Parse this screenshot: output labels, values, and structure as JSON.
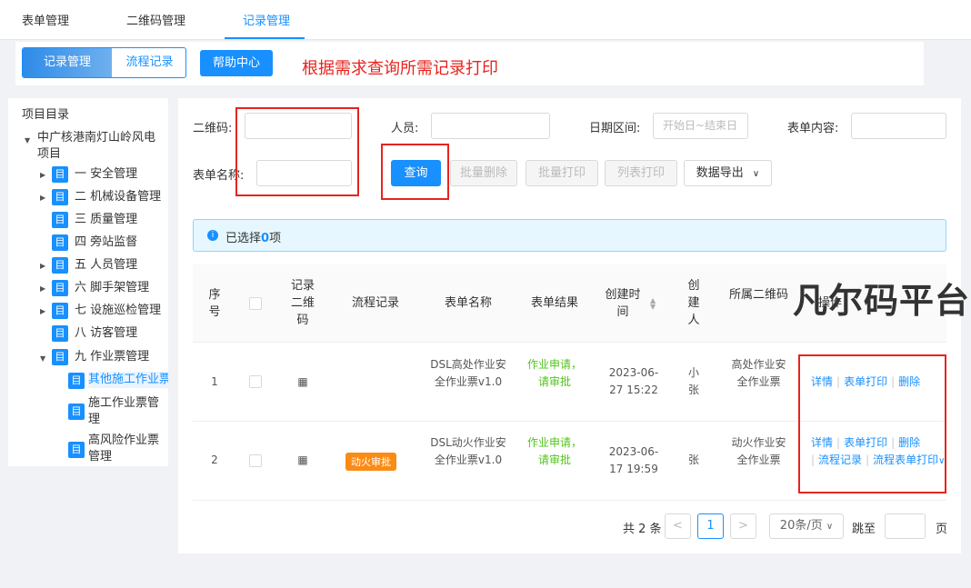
{
  "topnav": {
    "tabs": [
      "表单管理",
      "二维码管理",
      "记录管理"
    ]
  },
  "subbar": {
    "seg_active": "记录管理",
    "seg_other": "流程记录",
    "help": "帮助中心",
    "note": "根据需求查询所需记录打印"
  },
  "tree": {
    "title": "项目目录",
    "root": "中广核港南灯山岭风电项目",
    "icon": "目",
    "items": [
      "一 安全管理",
      "二 机械设备管理",
      "三 质量管理",
      "四 旁站监督",
      "五 人员管理",
      "六 脚手架管理",
      "七 设施巡检管理",
      "八 访客管理",
      "九 作业票管理"
    ],
    "sub": [
      "其他施工作业票",
      "施工作业票管理",
      "高风险作业票管理"
    ]
  },
  "filters": {
    "qrcode": "二维码:",
    "person": "人员:",
    "date": "日期区间:",
    "date_placeholder": "开始日~结束日",
    "content": "表单内容:",
    "formname": "表单名称:",
    "query": "查询",
    "batch_delete": "批量删除",
    "batch_print": "批量打印",
    "list_print": "列表打印",
    "export": "数据导出"
  },
  "alert": {
    "prefix": "已选择",
    "count": "0",
    "suffix": "项"
  },
  "table": {
    "headers": {
      "seq": "序号",
      "record_qr": "记录二维码",
      "flow": "流程记录",
      "name": "表单名称",
      "result": "表单结果",
      "created": "创建时间",
      "creator": "创建人",
      "qr_owner": "所属二维码",
      "ops": "操作"
    },
    "rows": [
      {
        "seq": "1",
        "flow": "",
        "name": "DSL高处作业安全作业票v1.0",
        "result": "作业申请，请审批",
        "created": "2023-06-27 15:22",
        "creator": "小张",
        "qr_owner": "高处作业安全作业票",
        "ops": [
          "详情",
          "表单打印",
          "删除"
        ]
      },
      {
        "seq": "2",
        "flow": "动火审批",
        "name": "DSL动火作业安全作业票v1.0",
        "result": "作业申请，请审批",
        "created": "2023-06-17 19:59",
        "creator": "张",
        "qr_owner": "动火作业安全作业票",
        "ops": [
          "详情",
          "表单打印",
          "删除",
          "流程记录",
          "流程表单打印"
        ]
      }
    ]
  },
  "pager": {
    "total": "共 2 条",
    "page": "1",
    "size": "20条/页",
    "jump": "跳至",
    "unit": "页"
  },
  "watermark": "凡尔码平台",
  "colors": {
    "accent": "#1890ff",
    "annotation": "#e8231e",
    "success": "#52c41a",
    "tag": "#fa8c16"
  }
}
